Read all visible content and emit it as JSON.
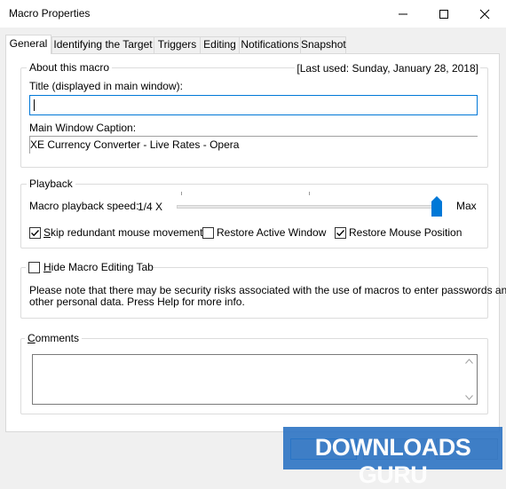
{
  "window": {
    "title": "Macro Properties"
  },
  "tabs": [
    {
      "label": "General"
    },
    {
      "label": "Identifying the Target"
    },
    {
      "label": "Triggers"
    },
    {
      "label": "Editing"
    },
    {
      "label": "Notifications"
    },
    {
      "label": "Snapshot"
    }
  ],
  "about": {
    "group_label": "About this macro",
    "last_used": "[Last used: Sunday, January 28, 2018]",
    "title_label": "Title (displayed in main window):",
    "title_value": "",
    "caption_label": "Main Window Caption:",
    "caption_value": "XE Currency Converter - Live Rates - Opera"
  },
  "playback": {
    "group_label": "Playback",
    "speed_label": "Macro playback speed:",
    "speed_min": "1/4 X",
    "speed_max": "Max",
    "speed_level": 1.0,
    "skip_label": "Skip redundant mouse movement",
    "skip_checked": true,
    "restore_window_label": "Restore Active Window",
    "restore_window_checked": false,
    "restore_mouse_label": "Restore Mouse Position",
    "restore_mouse_checked": true
  },
  "hide_tab": {
    "label": "Hide Macro Editing Tab",
    "checked": false,
    "note_line1": "Please note that there may be security risks associated with the use of macros to enter passwords and",
    "note_line2": "other personal data. Press Help for more info."
  },
  "comments": {
    "group_label": "Comments",
    "value": ""
  },
  "watermark": {
    "text": "DOWNLOADS GURU"
  }
}
